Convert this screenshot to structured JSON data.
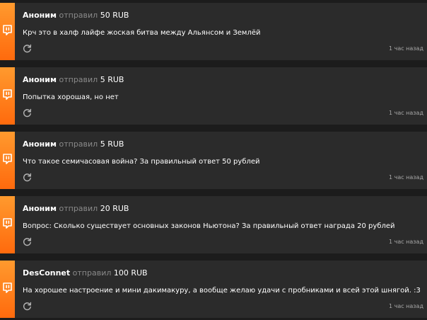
{
  "colors": {
    "background": "#1c1c1c",
    "card": "#2b2b2b",
    "accent": "#ff7a1a",
    "muted_text": "#8a8a8a"
  },
  "icons": {
    "brand": "donation-service-logo-icon",
    "refresh": "refresh-icon"
  },
  "donations": [
    {
      "sender": "Аноним",
      "action": "отправил",
      "amount": "50 RUB",
      "message": "Крч это в халф лайфе жоская битва между Альянсом и Землёй",
      "time": "1 час назад"
    },
    {
      "sender": "Аноним",
      "action": "отправил",
      "amount": "5 RUB",
      "message": "Попытка хорошая, но нет",
      "time": "1 час назад"
    },
    {
      "sender": "Аноним",
      "action": "отправил",
      "amount": "5 RUB",
      "message": "Что такое семичасовая война? За правильный ответ 50 рублей",
      "time": "1 час назад"
    },
    {
      "sender": "Аноним",
      "action": "отправил",
      "amount": "20 RUB",
      "message": "Вопрос: Сколько существует основных законов Ньютона? За правильный ответ награда 20 рублей",
      "time": "1 час назад"
    },
    {
      "sender": "DesConnet",
      "action": "отправил",
      "amount": "100 RUB",
      "message": "На хорошее настроение и мини дакимакуру, а вообще желаю удачи с пробниками и всей этой шнягой. :3",
      "time": "1 час назад"
    }
  ]
}
